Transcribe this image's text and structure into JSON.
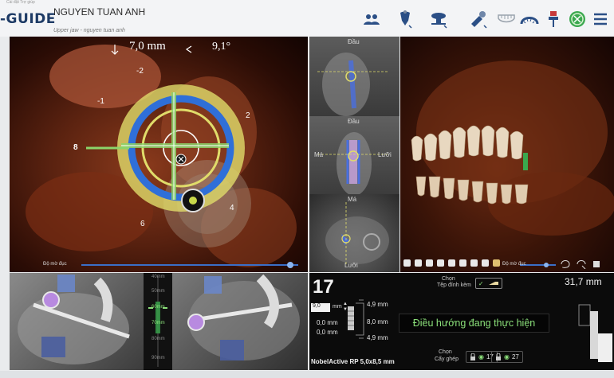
{
  "topbar": {
    "tiny": "Cài đặt    Trợ giúp",
    "logo": "-GUIDE",
    "patient_name": "NGUYEN TUAN ANH",
    "subtitle": "Upper jaw - nguyen tuan anh"
  },
  "toolbar": {
    "icons": [
      "users-icon",
      "tooth-view-icon",
      "implant-view-icon",
      "drill-icon",
      "jaw-teeth-icon",
      "arch-icon",
      "guide-settings-icon",
      "confirm-check-icon",
      "menu-icon"
    ]
  },
  "main3d": {
    "depth_reading": "7,0 mm",
    "angle_reading": "9,1°",
    "markers": [
      "-2",
      "-1",
      "2",
      "4",
      "6",
      "8"
    ],
    "slider_label": "Độ mờ đục"
  },
  "slices": {
    "a_top": "Đầu",
    "b_top": "Đầu",
    "b_left": "Má",
    "b_right": "Lưỡi",
    "c_top": "Má",
    "c_bottom": "Lưỡi"
  },
  "skull": {
    "slider_label": "Độ mờ đục"
  },
  "depth_scale": {
    "labels": [
      "40mm",
      "50mm",
      "60mm",
      "70mm",
      "80mm",
      "90mm"
    ]
  },
  "info": {
    "tooth_number": "17",
    "select_label": "Chọn",
    "attachment_label": "Tệp đính kèm",
    "distance": "31,7 mm",
    "input_value": "9,0",
    "input_unit": "mm",
    "offset_top": "0,0 mm",
    "offset_bottom": "0,0 mm",
    "dim_top": "4,9 mm",
    "dim_mid": "8,0 mm",
    "dim_bottom": "4,9 mm",
    "implant_name": "NobelActive RP 5,0x8,5 mm",
    "status": "Điều hướng đang thực hiện",
    "select_label2": "Chọn",
    "implant_label": "Cấy ghép",
    "lock1": "17",
    "lock2": "27"
  },
  "colors": {
    "accent_green": "#8be07a",
    "ring_blue": "#2f6fd8",
    "ring_yellow": "#d8d24a",
    "bone": "#e8d8c0"
  }
}
